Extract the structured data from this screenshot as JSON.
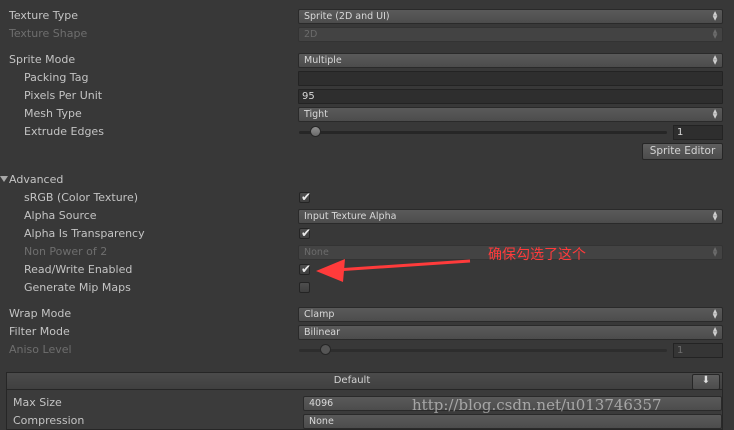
{
  "inspector": {
    "texture_type": {
      "label": "Texture Type",
      "value": "Sprite (2D and UI)"
    },
    "texture_shape": {
      "label": "Texture Shape",
      "value": "2D"
    },
    "sprite_mode": {
      "label": "Sprite Mode",
      "value": "Multiple"
    },
    "packing_tag": {
      "label": "Packing Tag",
      "value": ""
    },
    "pixels_per_unit": {
      "label": "Pixels Per Unit",
      "value": "95"
    },
    "mesh_type": {
      "label": "Mesh Type",
      "value": "Tight"
    },
    "extrude_edges": {
      "label": "Extrude Edges",
      "value": "1",
      "slider_fraction": 0.03
    },
    "sprite_editor_button": "Sprite Editor",
    "advanced": {
      "label": "Advanced"
    },
    "srgb": {
      "label": "sRGB (Color Texture)",
      "checked": true
    },
    "alpha_source": {
      "label": "Alpha Source",
      "value": "Input Texture Alpha"
    },
    "alpha_is_transparency": {
      "label": "Alpha Is Transparency",
      "checked": true
    },
    "non_power_of_2": {
      "label": "Non Power of 2",
      "value": "None"
    },
    "read_write_enabled": {
      "label": "Read/Write Enabled",
      "checked": true
    },
    "generate_mip_maps": {
      "label": "Generate Mip Maps",
      "checked": false
    },
    "wrap_mode": {
      "label": "Wrap Mode",
      "value": "Clamp"
    },
    "filter_mode": {
      "label": "Filter Mode",
      "value": "Bilinear"
    },
    "aniso_level": {
      "label": "Aniso Level",
      "value": "1",
      "slider_fraction": 0.06
    },
    "platform": {
      "tab_label": "Default",
      "max_size": {
        "label": "Max Size",
        "value": "4096"
      },
      "compression": {
        "label": "Compression",
        "value": "None"
      }
    }
  },
  "checkmark_glyph": "✔",
  "download_icon": "download-icon",
  "annotation": {
    "text": "确保勾选了这个",
    "color": "#ff3b3b"
  },
  "watermark": "http://blog.csdn.net/u013746357",
  "colors": {
    "background": "#383838",
    "text": "#c4c4c4",
    "disabled_text": "#6e6e6e",
    "annotation": "#ff3b3b"
  }
}
